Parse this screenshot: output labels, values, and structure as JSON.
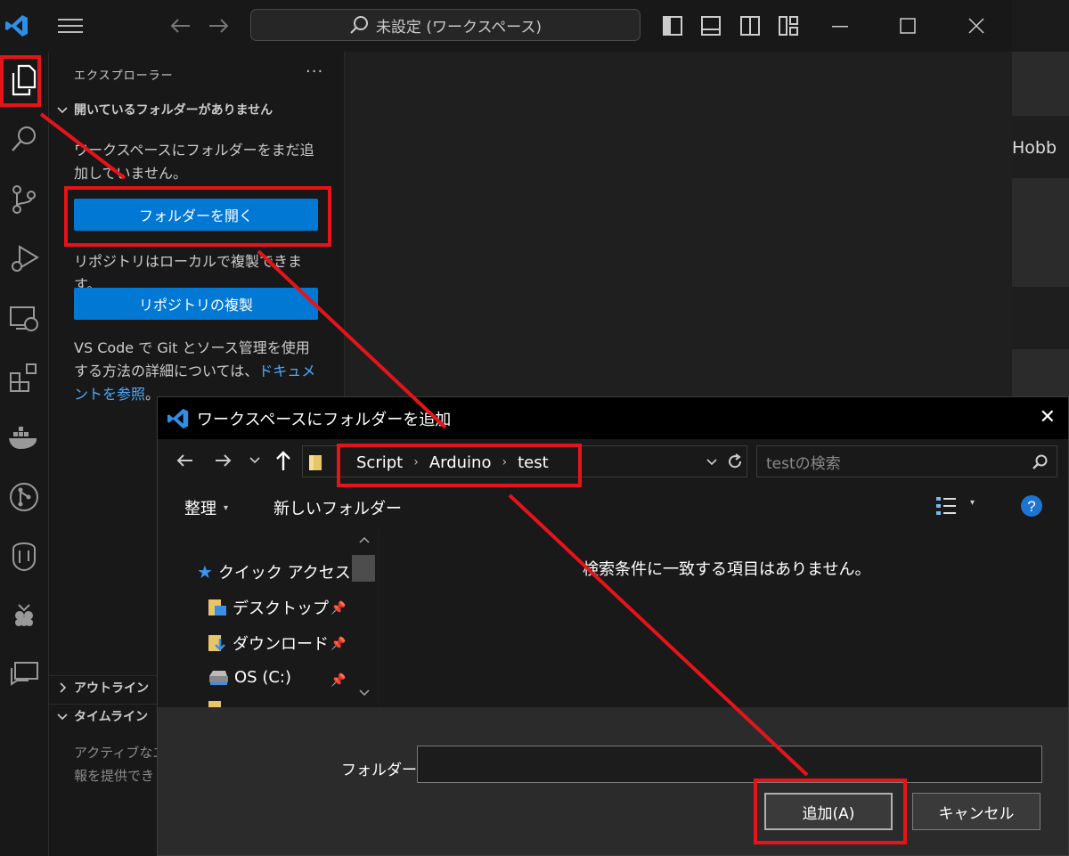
{
  "window": {
    "search_text": "未設定 (ワークスペース)"
  },
  "background_window": {
    "partial_text": "Hobb"
  },
  "activity_bar": {
    "items": [
      {
        "icon": "explorer-icon"
      },
      {
        "icon": "search-icon"
      },
      {
        "icon": "source-control-icon"
      },
      {
        "icon": "run-debug-icon"
      },
      {
        "icon": "remote-explorer-icon"
      },
      {
        "icon": "extensions-icon"
      },
      {
        "icon": "docker-icon"
      },
      {
        "icon": "git-graph-icon"
      },
      {
        "icon": "database-icon"
      },
      {
        "icon": "raspberry-icon"
      },
      {
        "icon": "live-share-chat-icon"
      }
    ]
  },
  "sidebar": {
    "title": "エクスプローラー",
    "more": "···",
    "section_title": "開いているフォルダーがありません",
    "msg_no_folder": "ワークスペースにフォルダーをまだ追加していません。",
    "open_folder_button": "フォルダーを開く",
    "msg_clone": "リポジトリはローカルで複製できます。",
    "clone_button": "リポジトリの複製",
    "msg_git_prefix": "VS Code で Git とソース管理を使用する方法の詳細については、",
    "msg_git_link": "ドキュメントを参照",
    "msg_git_suffix": "。",
    "outline": "アウトライン",
    "timeline": "タイムライン",
    "timeline_msg_line1": "アクティブなエ",
    "timeline_msg_line2": "報を提供でき"
  },
  "dialog": {
    "title": "ワークスペースにフォルダーを追加",
    "close": "✕",
    "breadcrumb": [
      "Script",
      "Arduino",
      "test"
    ],
    "search_placeholder": "testの検索",
    "organize": "整理",
    "new_folder": "新しいフォルダー",
    "help": "?",
    "nav": {
      "quick_access": "クイック アクセス",
      "desktop": "デスクトップ",
      "downloads": "ダウンロード",
      "os_drive": "OS (C:)"
    },
    "empty_message": "検索条件に一致する項目はありません。",
    "folder_label": "フォルダー:",
    "folder_value": "",
    "add_button": "追加(A)",
    "cancel_button": "キャンセル"
  },
  "colors": {
    "accent_blue": "#0078d4",
    "annotation_red": "#e5141a",
    "link": "#4daafc"
  }
}
